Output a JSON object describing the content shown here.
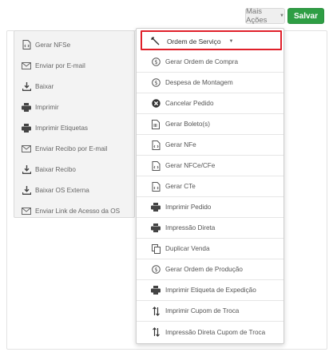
{
  "toolbar": {
    "more_actions_label": "Mais Ações",
    "save_label": "Salvar"
  },
  "left_menu": {
    "items": [
      {
        "label": "Gerar NFSe",
        "icon": "code-file-icon"
      },
      {
        "label": "Enviar por E-mail",
        "icon": "envelope-icon"
      },
      {
        "label": "Baixar",
        "icon": "download-icon"
      },
      {
        "label": "Imprimir",
        "icon": "printer-icon"
      },
      {
        "label": "Imprimir Etiquetas",
        "icon": "printer-icon"
      },
      {
        "label": "Enviar Recibo por E-mail",
        "icon": "envelope-icon"
      },
      {
        "label": "Baixar Recibo",
        "icon": "download-icon"
      },
      {
        "label": "Baixar OS Externa",
        "icon": "download-icon"
      },
      {
        "label": "Enviar Link de Acesso da OS",
        "icon": "envelope-icon"
      }
    ]
  },
  "right_menu": {
    "header": {
      "label": "Ordem de Serviço",
      "icon": "wrench-icon"
    },
    "items": [
      {
        "label": "Gerar Ordem de Compra",
        "icon": "dollar-circle-icon"
      },
      {
        "label": "Despesa de Montagem",
        "icon": "dollar-circle-icon"
      },
      {
        "label": "Cancelar Pedido",
        "icon": "x-circle-icon"
      },
      {
        "label": "Gerar Boleto(s)",
        "icon": "barcode-file-icon"
      },
      {
        "label": "Gerar NFe",
        "icon": "code-file-icon"
      },
      {
        "label": "Gerar NFCe/CFe",
        "icon": "code-file-icon"
      },
      {
        "label": "Gerar CTe",
        "icon": "code-file-icon"
      },
      {
        "label": "Imprimir Pedido",
        "icon": "printer-icon"
      },
      {
        "label": "Impressão Direta",
        "icon": "printer-icon"
      },
      {
        "label": "Duplicar Venda",
        "icon": "copy-icon"
      },
      {
        "label": "Gerar Ordem de Produção",
        "icon": "dollar-circle-icon"
      },
      {
        "label": "Imprimir Etiqueta de Expedição",
        "icon": "printer-icon"
      },
      {
        "label": "Imprimir Cupom de Troca",
        "icon": "swap-arrows-icon"
      },
      {
        "label": "Impressão Direta Cupom de Troca",
        "icon": "swap-arrows-icon"
      }
    ]
  },
  "colors": {
    "save_button": "#2e9e44",
    "highlight_border": "#e0202a"
  }
}
